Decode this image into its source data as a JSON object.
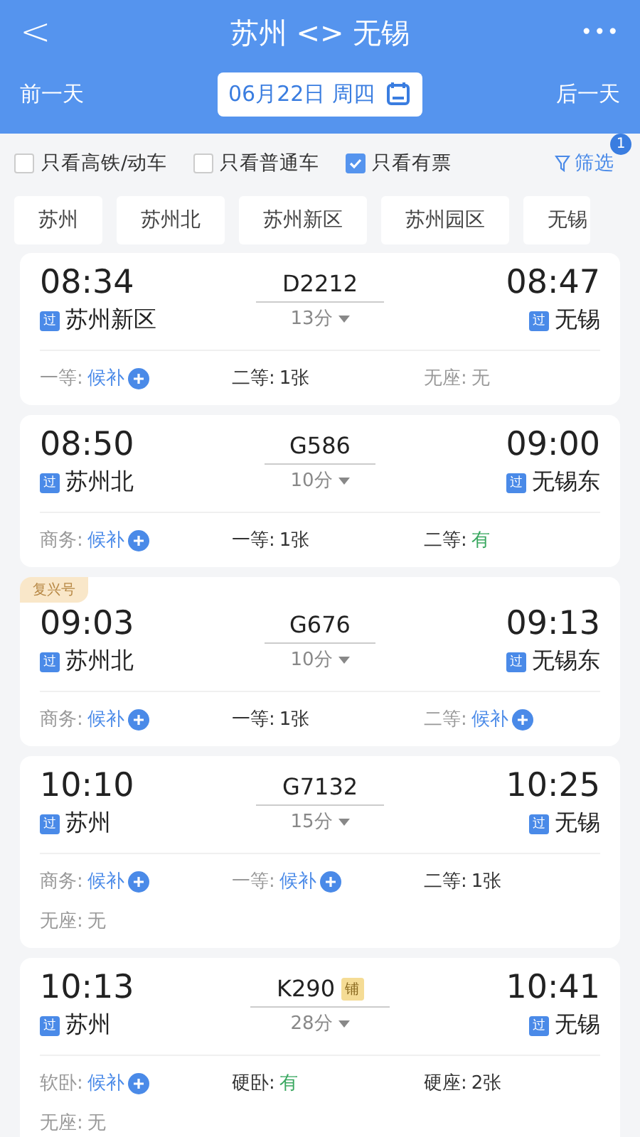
{
  "header": {
    "back": "<",
    "title": "苏州 <> 无锡",
    "more": "•••",
    "prev_day": "前一天",
    "date": "06月22日 周四",
    "next_day": "后一天"
  },
  "filters": [
    {
      "label": "只看高铁/动车",
      "checked": false
    },
    {
      "label": "只看普通车",
      "checked": false
    },
    {
      "label": "只看有票",
      "checked": true
    }
  ],
  "filter_button": {
    "label": "筛选",
    "badge": "1"
  },
  "stations": [
    "苏州",
    "苏州北",
    "苏州新区",
    "苏州园区",
    "无锡"
  ],
  "trains": [
    {
      "depart": "08:34",
      "from": "苏州新区",
      "from_badge": "过",
      "number": "D2212",
      "duration": "13分",
      "arrive": "08:47",
      "to": "无锡",
      "to_badge": "过",
      "seats": [
        {
          "label": "一等:",
          "value": "候补",
          "kind": "waitlist"
        },
        {
          "label": "二等:",
          "value": "1张",
          "kind": "count"
        },
        {
          "label": "无座:",
          "value": "无",
          "kind": "none"
        }
      ]
    },
    {
      "depart": "08:50",
      "from": "苏州北",
      "from_badge": "过",
      "number": "G586",
      "duration": "10分",
      "arrive": "09:00",
      "to": "无锡东",
      "to_badge": "过",
      "seats": [
        {
          "label": "商务:",
          "value": "候补",
          "kind": "waitlist"
        },
        {
          "label": "一等:",
          "value": "1张",
          "kind": "count"
        },
        {
          "label": "二等:",
          "value": "有",
          "kind": "available"
        }
      ]
    },
    {
      "tag": "复兴号",
      "depart": "09:03",
      "from": "苏州北",
      "from_badge": "过",
      "number": "G676",
      "duration": "10分",
      "arrive": "09:13",
      "to": "无锡东",
      "to_badge": "过",
      "seats": [
        {
          "label": "商务:",
          "value": "候补",
          "kind": "waitlist"
        },
        {
          "label": "一等:",
          "value": "1张",
          "kind": "count"
        },
        {
          "label": "二等:",
          "value": "候补",
          "kind": "waitlist"
        }
      ]
    },
    {
      "depart": "10:10",
      "from": "苏州",
      "from_badge": "过",
      "number": "G7132",
      "duration": "15分",
      "arrive": "10:25",
      "to": "无锡",
      "to_badge": "过",
      "seats": [
        {
          "label": "商务:",
          "value": "候补",
          "kind": "waitlist"
        },
        {
          "label": "一等:",
          "value": "候补",
          "kind": "waitlist"
        },
        {
          "label": "二等:",
          "value": "1张",
          "kind": "count"
        },
        {
          "label": "无座:",
          "value": "无",
          "kind": "none"
        }
      ]
    },
    {
      "depart": "10:13",
      "from": "苏州",
      "from_badge": "过",
      "number": "K290",
      "number_badge": "铺",
      "duration": "28分",
      "arrive": "10:41",
      "to": "无锡",
      "to_badge": "过",
      "seats": [
        {
          "label": "软卧:",
          "value": "候补",
          "kind": "waitlist"
        },
        {
          "label": "硬卧:",
          "value": "有",
          "kind": "available"
        },
        {
          "label": "硬座:",
          "value": "2张",
          "kind": "count"
        },
        {
          "label": "无座:",
          "value": "无",
          "kind": "none"
        }
      ]
    }
  ]
}
